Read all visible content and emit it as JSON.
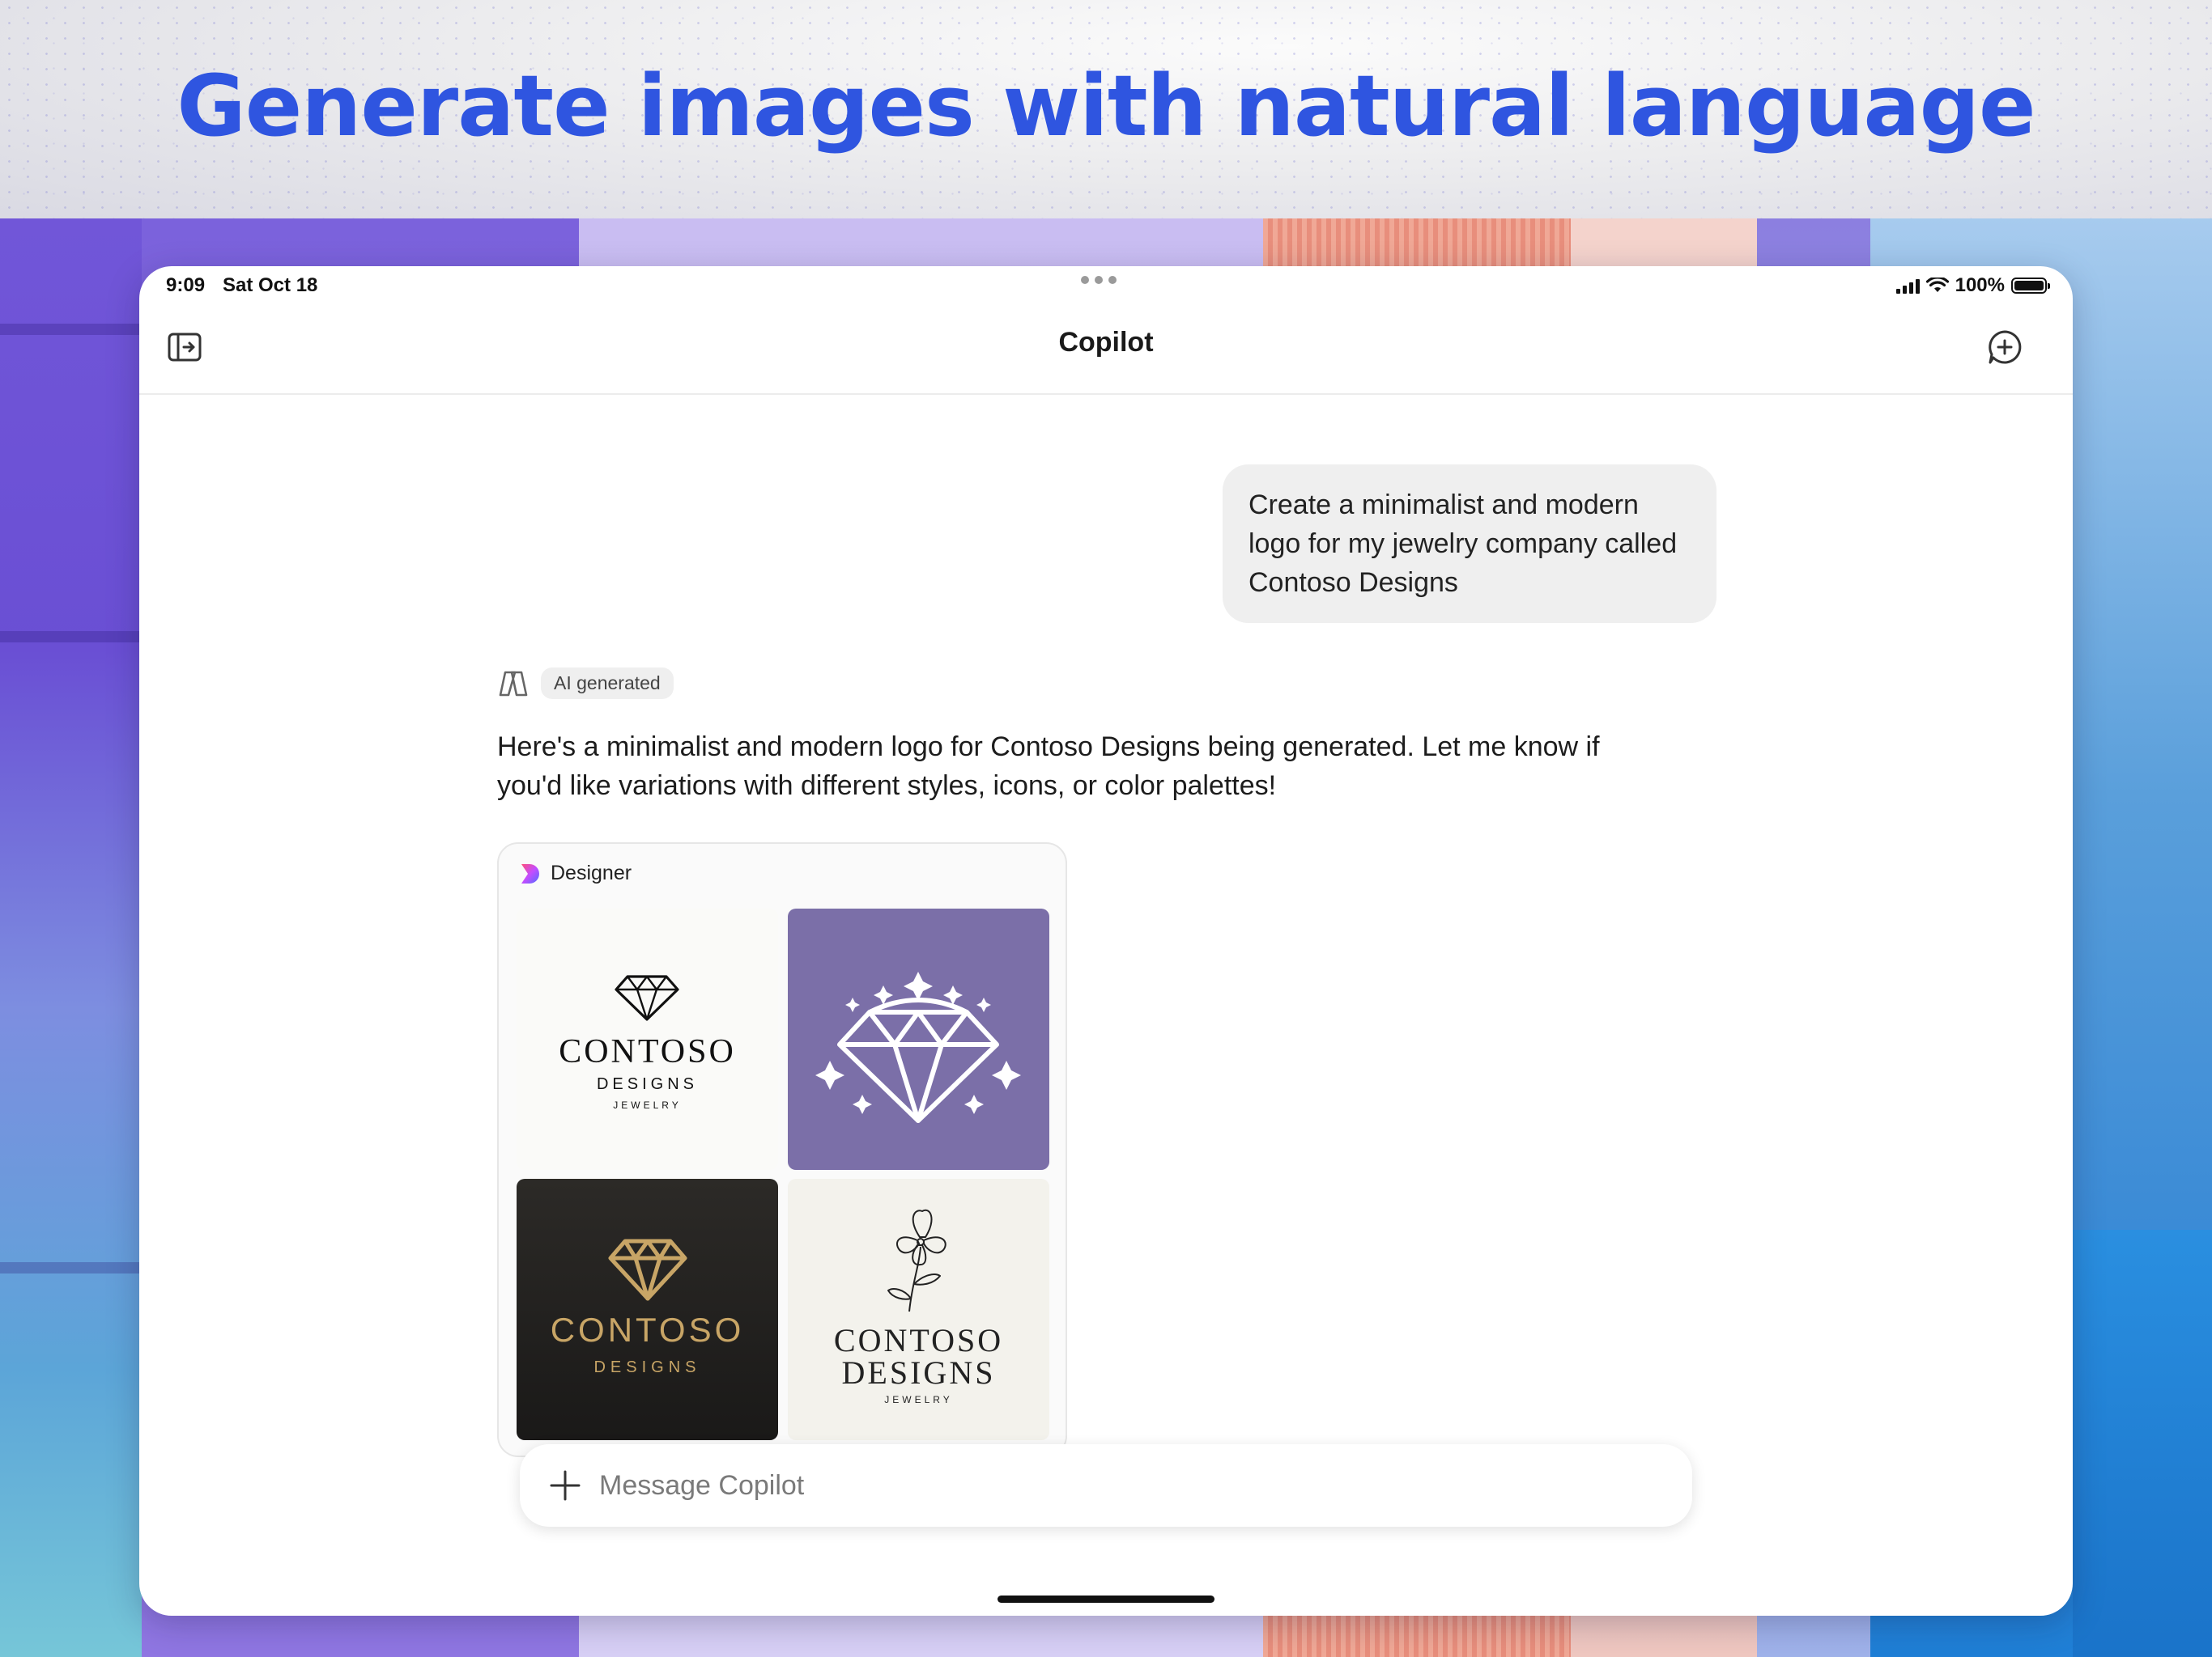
{
  "headline": "Generate images with natural language",
  "status_bar": {
    "time": "9:09",
    "date": "Sat Oct 18",
    "battery": "100%"
  },
  "nav": {
    "title": "Copilot"
  },
  "chat": {
    "user_message": "Create a minimalist and modern logo for my jewelry company called Contoso Designs",
    "ai_badge": "AI generated",
    "ai_message": "Here's a minimalist and modern logo for Contoso Designs being generated. Let me know if you'd like variations with different styles, icons, or color palettes!"
  },
  "designer": {
    "label": "Designer",
    "images": [
      {
        "line1": "CONTOSO",
        "line2": "DESIGNS",
        "line3": "JEWELRY",
        "style": "black-on-white",
        "icon": "diamond-outline-icon"
      },
      {
        "style": "white-diamond-on-purple",
        "icon": "diamond-sparkles-icon",
        "bg": "#7b6fa8"
      },
      {
        "line1": "CONTOSO",
        "line2": "DESIGNS",
        "style": "gold-on-black",
        "icon": "gold-diamond-icon",
        "accent": "#c8a566"
      },
      {
        "line1": "CONTOSO",
        "line2": "DESIGNS",
        "line3": "JEWELRY",
        "style": "floral-on-cream",
        "icon": "flower-icon"
      }
    ]
  },
  "composer": {
    "placeholder": "Message Copilot"
  },
  "colors": {
    "headline": "#2f55e0",
    "user_bubble": "#efefef",
    "tile_purple": "#7b6fa8",
    "gold": "#c8a566"
  }
}
